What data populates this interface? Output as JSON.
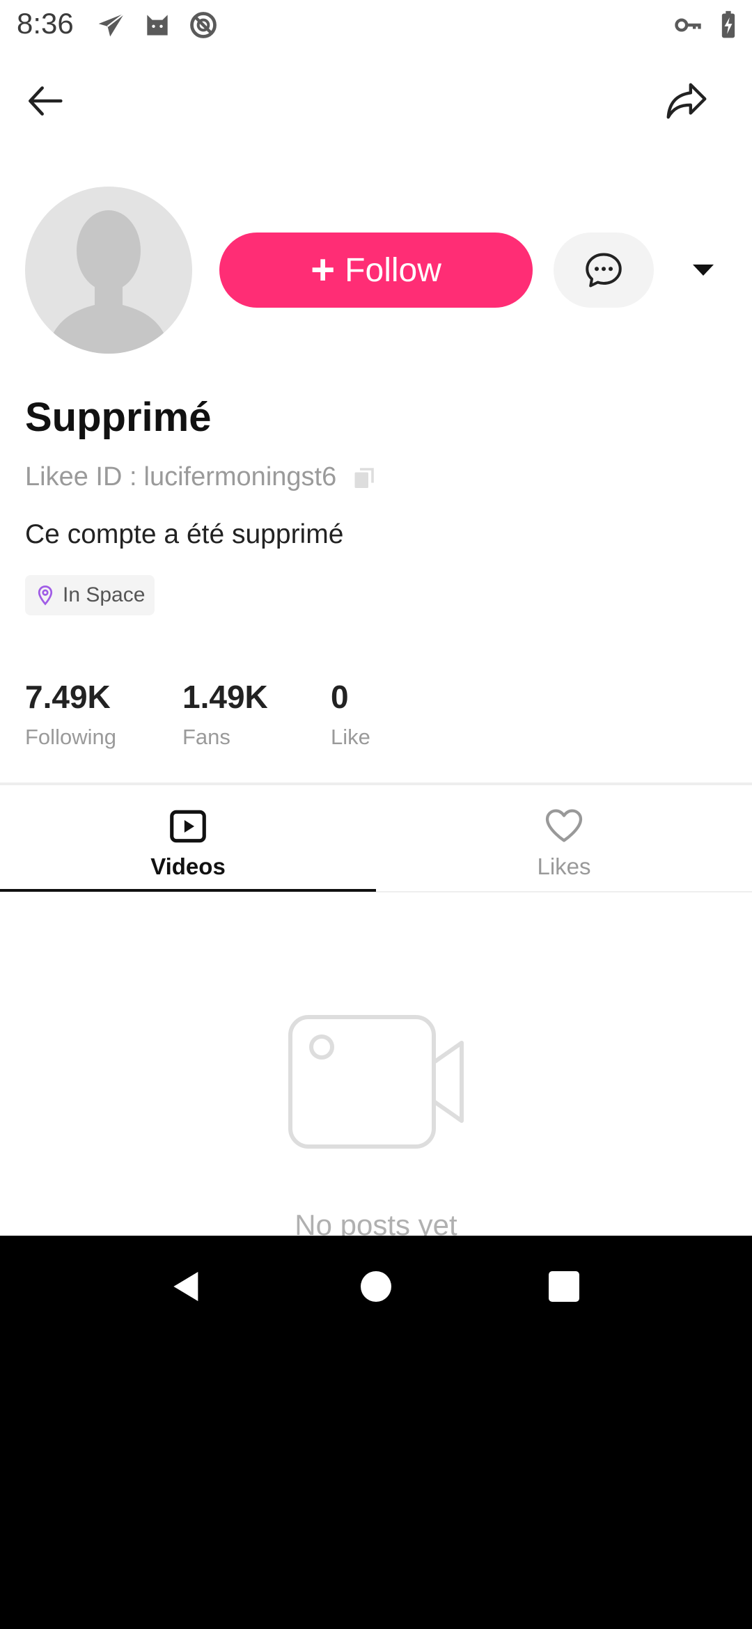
{
  "status_bar": {
    "time": "8:36",
    "left_icons": [
      "send-icon",
      "cat-icon",
      "no-sync-icon"
    ],
    "right_icons": [
      "key-icon",
      "battery-charging-icon"
    ]
  },
  "header": {
    "back_icon": "arrow-left-icon",
    "share_icon": "share-icon"
  },
  "profile": {
    "follow_label": "Follow",
    "follow_plus": "+",
    "display_name": "Supprimé",
    "likee_id_label": "Likee ID :",
    "likee_id_value": "lucifermoningst6",
    "bio": "Ce compte a été supprimé",
    "location": "In Space"
  },
  "stats": [
    {
      "value": "7.49K",
      "label": "Following"
    },
    {
      "value": "1.49K",
      "label": "Fans"
    },
    {
      "value": "0",
      "label": "Like"
    }
  ],
  "tabs": [
    {
      "label": "Videos",
      "icon": "play-square-icon",
      "active": true
    },
    {
      "label": "Likes",
      "icon": "heart-icon",
      "active": false
    }
  ],
  "empty_state": {
    "text": "No posts yet"
  },
  "colors": {
    "accent": "#ff2d75",
    "location_pin": "#a05ce6"
  }
}
